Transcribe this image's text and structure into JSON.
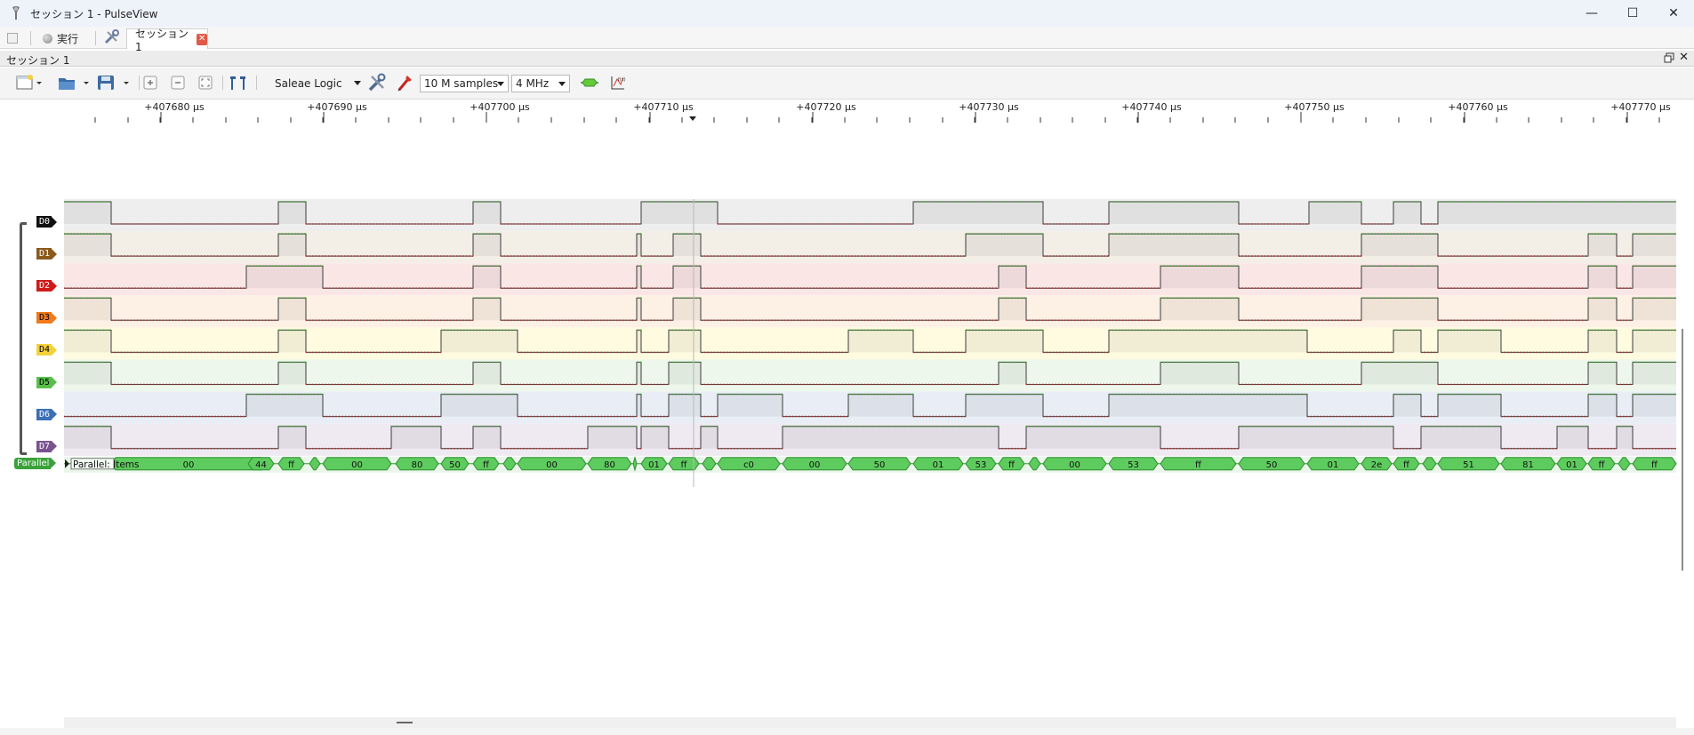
{
  "window": {
    "title": "セッション 1 - PulseView",
    "controls": {
      "minimize": "—",
      "maximize": "☐",
      "close": "✕"
    }
  },
  "tabbar": {
    "run_label": "実行",
    "session_tab_label": "セッション 1",
    "tab_close": "✕"
  },
  "dock": {
    "title": "セッション 1",
    "close": "✕"
  },
  "toolbar": {
    "device": "Saleae Logic",
    "samples": "10 M samples",
    "samplerate": "4 MHz"
  },
  "ruler": {
    "labels": [
      "+407680 µs",
      "+407690 µs",
      "+407700 µs",
      "+407710 µs",
      "+407720 µs",
      "+407730 µs",
      "+407740 µs",
      "+407750 µs",
      "+407760 µs",
      "+407770 µs"
    ]
  },
  "channels": [
    {
      "name": "D0",
      "color": "#111111",
      "text": "#ffffff",
      "bg": "#eeeeee",
      "edges": [
        72,
        125,
        313,
        344,
        532,
        563,
        721,
        807,
        1027,
        1173,
        1247,
        1393,
        1472,
        1531,
        1567,
        1598,
        1617,
        1885
      ],
      "start": 1
    },
    {
      "name": "D1",
      "color": "#8b5a1b",
      "text": "#ffffff",
      "bg": "#f3eee6",
      "edges": [
        72,
        125,
        313,
        344,
        532,
        563,
        716,
        721,
        757,
        788,
        1086,
        1173,
        1247,
        1393,
        1531,
        1617,
        1786,
        1818,
        1836,
        1885
      ],
      "start": 1
    },
    {
      "name": "D2",
      "color": "#d01a1a",
      "text": "#ffffff",
      "bg": "#fbe6e6",
      "edges": [
        277,
        363,
        532,
        563,
        716,
        721,
        757,
        788,
        1123,
        1154,
        1305,
        1393,
        1531,
        1617,
        1786,
        1818,
        1836,
        1885
      ],
      "start": 0
    },
    {
      "name": "D3",
      "color": "#f07a1c",
      "text": "#000000",
      "bg": "#fdf0e4",
      "edges": [
        72,
        125,
        313,
        344,
        532,
        563,
        716,
        721,
        757,
        788,
        1123,
        1154,
        1305,
        1393,
        1531,
        1617,
        1786,
        1818,
        1836,
        1885
      ],
      "start": 1
    },
    {
      "name": "D4",
      "color": "#f3d23b",
      "text": "#000000",
      "bg": "#fefbe1",
      "edges": [
        72,
        125,
        313,
        344,
        496,
        582,
        716,
        721,
        752,
        788,
        954,
        1027,
        1086,
        1173,
        1247,
        1470,
        1567,
        1598,
        1617,
        1688,
        1786,
        1818,
        1836,
        1885
      ],
      "start": 1
    },
    {
      "name": "D5",
      "color": "#58c04a",
      "text": "#000000",
      "bg": "#eef7eb",
      "edges": [
        72,
        125,
        313,
        344,
        532,
        563,
        716,
        721,
        752,
        788,
        1123,
        1154,
        1305,
        1393,
        1531,
        1617,
        1786,
        1818,
        1836,
        1885
      ],
      "start": 1
    },
    {
      "name": "D6",
      "color": "#3b6fb6",
      "text": "#ffffff",
      "bg": "#e9eef6",
      "edges": [
        277,
        363,
        496,
        582,
        716,
        721,
        752,
        788,
        807,
        880,
        954,
        1027,
        1086,
        1173,
        1247,
        1470,
        1567,
        1598,
        1617,
        1688,
        1786,
        1818,
        1836,
        1885
      ],
      "start": 0
    },
    {
      "name": "D7",
      "color": "#7a5290",
      "text": "#ffffff",
      "bg": "#efe9f2",
      "edges": [
        72,
        125,
        313,
        344,
        440,
        496,
        532,
        563,
        661,
        716,
        721,
        752,
        788,
        807,
        880,
        1123,
        1154,
        1305,
        1393,
        1567,
        1598,
        1688,
        1751,
        1786,
        1818,
        1836,
        1885
      ],
      "start": 1
    }
  ],
  "decoder": {
    "name": "Parallel",
    "row_label": "Parallel: Items",
    "color": "#5ecb5e",
    "segments": [
      [
        "00",
        125,
        299
      ],
      [
        "44",
        279,
        308
      ],
      [
        "ff",
        313,
        342
      ],
      [
        "",
        348,
        360
      ],
      [
        "00",
        363,
        440
      ],
      [
        "80",
        445,
        493
      ],
      [
        "50",
        496,
        527
      ],
      [
        "ff",
        532,
        561
      ],
      [
        "",
        566,
        580
      ],
      [
        "00",
        582,
        659
      ],
      [
        "80",
        661,
        710
      ],
      [
        "",
        712,
        716
      ],
      [
        "01",
        721,
        750
      ],
      [
        "ff",
        752,
        786
      ],
      [
        "",
        790,
        805
      ],
      [
        "c0",
        807,
        877
      ],
      [
        "00",
        880,
        952
      ],
      [
        "50",
        954,
        1024
      ],
      [
        "01",
        1027,
        1083
      ],
      [
        "53",
        1086,
        1120
      ],
      [
        "ff",
        1123,
        1152
      ],
      [
        "",
        1157,
        1170
      ],
      [
        "00",
        1173,
        1244
      ],
      [
        "53",
        1247,
        1302
      ],
      [
        "ff",
        1305,
        1390
      ],
      [
        "50",
        1393,
        1467
      ],
      [
        "01",
        1470,
        1528
      ],
      [
        "2e",
        1531,
        1565
      ],
      [
        "ff",
        1567,
        1596
      ],
      [
        "",
        1600,
        1615
      ],
      [
        "51",
        1617,
        1686
      ],
      [
        "81",
        1688,
        1749
      ],
      [
        "01",
        1751,
        1784
      ],
      [
        "ff",
        1786,
        1816
      ],
      [
        "",
        1820,
        1833
      ],
      [
        "ff",
        1836,
        1885
      ]
    ]
  }
}
